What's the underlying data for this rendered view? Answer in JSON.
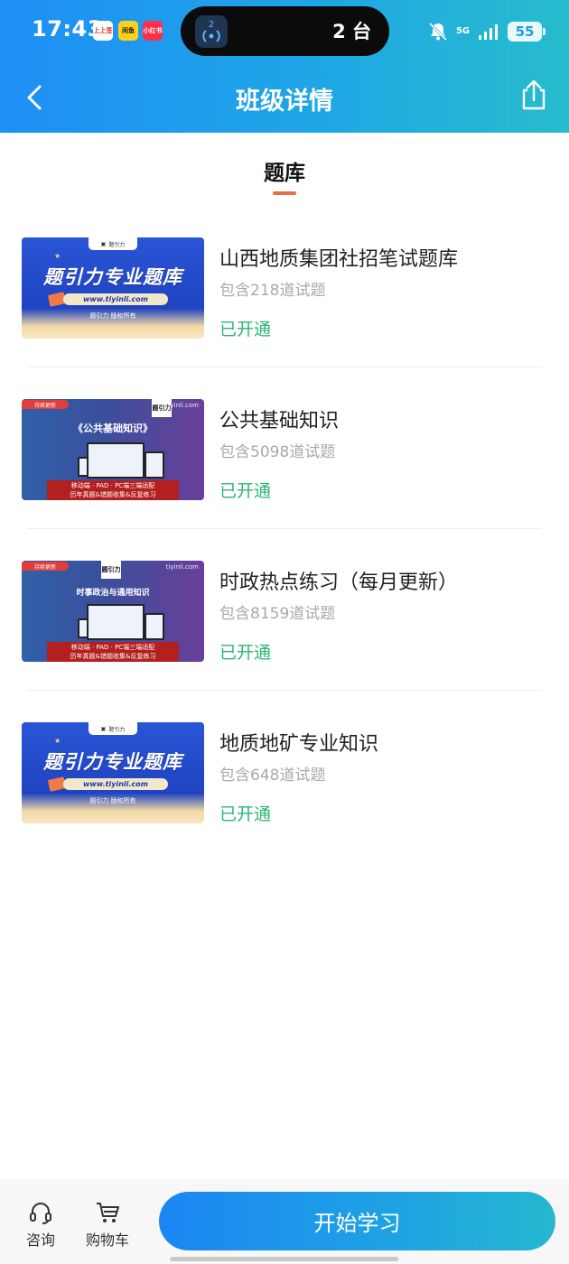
{
  "status_bar": {
    "time": "17:43",
    "mini_apps": [
      "上上签",
      "闲鱼",
      "小红书"
    ],
    "island_count": "2",
    "island_text": "2 台",
    "network": "5G",
    "battery": "55"
  },
  "nav": {
    "title": "班级详情"
  },
  "section": {
    "title": "题库",
    "accent_color": "#f06a42"
  },
  "items": [
    {
      "name": "山西地质集团社招笔试题库",
      "count": "包含218道试题",
      "status": "已开通",
      "thumb": {
        "style": "blue",
        "logo": "题引力",
        "headline": "题引力专业题库",
        "url": "www.tiyinli.com",
        "copyright": "题引力 版权所有"
      }
    },
    {
      "name": "公共基础知识",
      "count": "包含5098道试题",
      "status": "已开通",
      "thumb": {
        "style": "purple",
        "badge": "持续更新",
        "brand": "题引力",
        "site": "tiyinli.com",
        "headline": "《公共基础知识》",
        "banner_line1": "移动端 · PAD · PC端三端适配",
        "banner_line2": "历年真题&错题收集&反复练习"
      }
    },
    {
      "name": "时政热点练习（每月更新）",
      "count": "包含8159道试题",
      "status": "已开通",
      "thumb": {
        "style": "purple",
        "badge": "持续更新",
        "brand": "题引力",
        "site": "tiyinli.com",
        "headline": "时事政治与通用知识",
        "banner_line1": "移动端 · PAD · PC端三端适配",
        "banner_line2": "历年真题&错题收集&反复练习"
      }
    },
    {
      "name": "地质地矿专业知识",
      "count": "包含648道试题",
      "status": "已开通",
      "thumb": {
        "style": "blue",
        "logo": "题引力",
        "headline": "题引力专业题库",
        "url": "www.tiyinli.com",
        "copyright": "题引力 版权所有"
      }
    }
  ],
  "bottom_bar": {
    "consult_label": "咨询",
    "cart_label": "购物车",
    "start_label": "开始学习"
  },
  "colors": {
    "open_status": "#2bb673",
    "primary": "#1e8ff5"
  }
}
